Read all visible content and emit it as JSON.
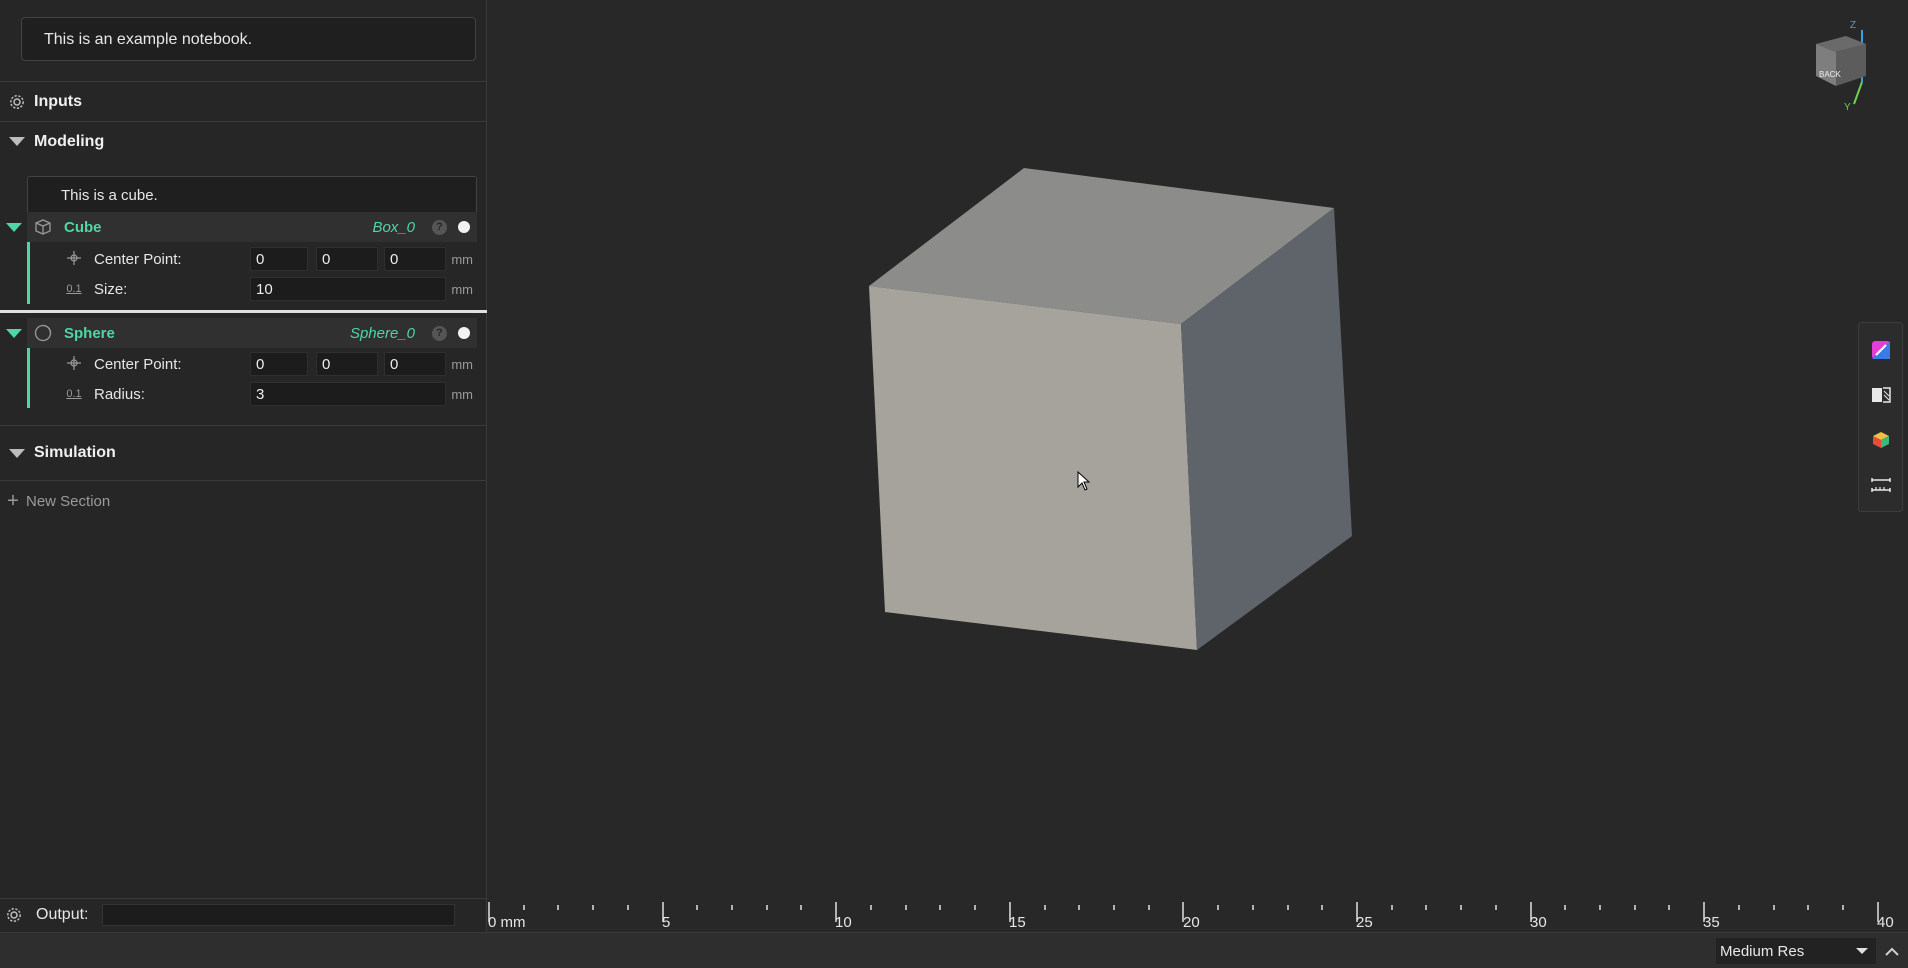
{
  "notebook": {
    "description": "This is an example notebook."
  },
  "sections": {
    "inputs": "Inputs",
    "modeling": "Modeling",
    "simulation": "Simulation",
    "new_section": "New Section"
  },
  "modeling": {
    "note": "This is a cube.",
    "features": [
      {
        "name": "Cube",
        "id": "Box_0",
        "icon": "cube-icon",
        "params": [
          {
            "label": "Center Point:",
            "values": [
              "0",
              "0",
              "0"
            ],
            "unit": "mm",
            "icon": "crosshair-icon"
          },
          {
            "label": "Size:",
            "value": "10",
            "unit": "mm",
            "icon": "decimal-icon",
            "icon_text": "0.1"
          }
        ]
      },
      {
        "name": "Sphere",
        "id": "Sphere_0",
        "icon": "sphere-icon",
        "params": [
          {
            "label": "Center Point:",
            "values": [
              "0",
              "0",
              "0"
            ],
            "unit": "mm",
            "icon": "crosshair-icon"
          },
          {
            "label": "Radius:",
            "value": "3",
            "unit": "mm",
            "icon": "decimal-icon",
            "icon_text": "0.1"
          }
        ]
      }
    ],
    "help_glyph": "?"
  },
  "output": {
    "label": "Output:",
    "value": ""
  },
  "status": {
    "resolution": "Medium Res"
  },
  "ruler": {
    "labels": [
      "0 mm",
      "5",
      "10",
      "15",
      "20",
      "25",
      "30",
      "35",
      "40"
    ]
  },
  "view_cube": {
    "face_label": "BACK",
    "axes": [
      "Z",
      "Y"
    ]
  },
  "colors": {
    "accent": "#4fd6a4",
    "background": "#282828",
    "panel": "#262626"
  }
}
